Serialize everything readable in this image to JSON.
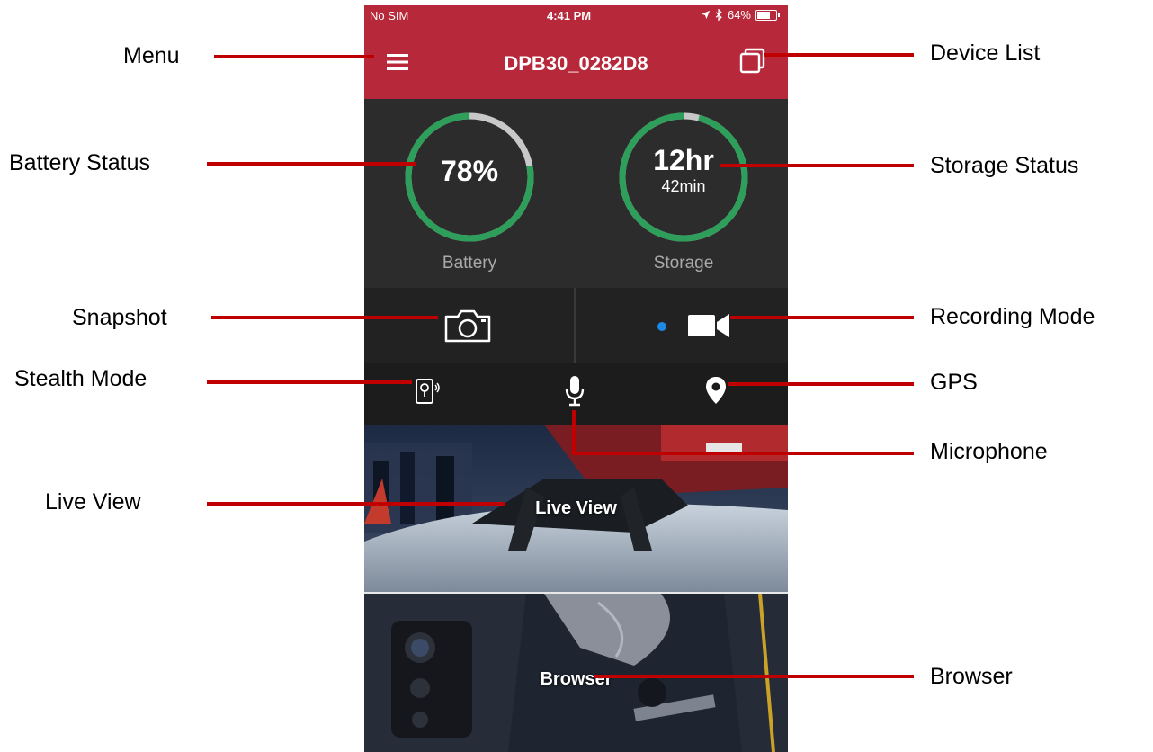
{
  "status_bar": {
    "carrier": "No SIM",
    "time": "4:41 PM",
    "battery_percent": "64%",
    "battery_level": 0.64
  },
  "header": {
    "device_name": "DPB30_0282D8",
    "menu_icon": "hamburger-menu-icon",
    "device_list_icon": "stacked-squares-icon"
  },
  "battery": {
    "value": "78%",
    "label": "Battery",
    "level": 0.78
  },
  "storage": {
    "value": "12hr",
    "sub": "42min",
    "label": "Storage",
    "level": 0.96
  },
  "actions": {
    "snapshot_icon": "camera-icon",
    "record_icon": "video-camera-icon",
    "record_indicator_color": "#1e88e5"
  },
  "controls": {
    "stealth_icon": "stealth-mode-icon",
    "mic_icon": "microphone-icon",
    "gps_icon": "map-pin-icon"
  },
  "tiles": {
    "live_view": "Live View",
    "browser": "Browser"
  },
  "annotations": {
    "menu": "Menu",
    "device_list": "Device List",
    "battery_status": "Battery  Status",
    "storage_status": "Storage Status",
    "snapshot": "Snapshot",
    "recording_mode": "Recording Mode",
    "stealth_mode": "Stealth  Mode",
    "gps": "GPS",
    "microphone": "Microphone",
    "live_view": "Live  View",
    "browser": "Browser"
  },
  "colors": {
    "brand_red": "#b7283a",
    "gauge_green": "#2e9e5b",
    "gauge_remaining": "#c8c8c8",
    "annotation_red": "#c00000"
  }
}
